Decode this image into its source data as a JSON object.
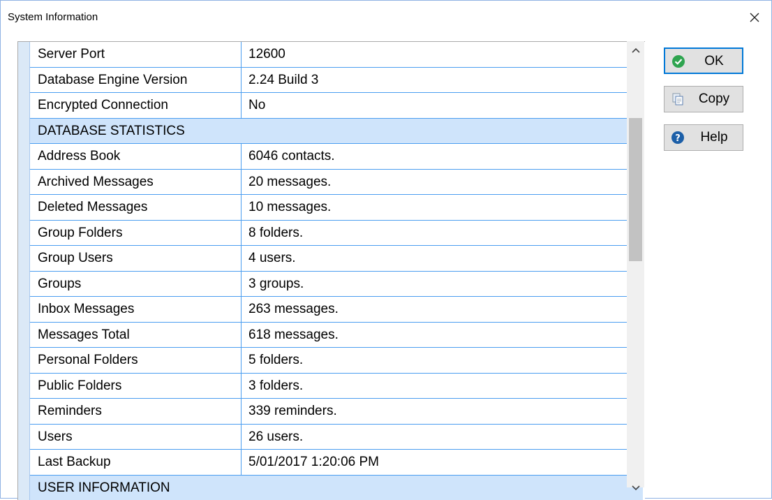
{
  "window": {
    "title": "System Information",
    "close_glyph": "✕"
  },
  "properties": [
    {
      "name": "Server Port",
      "value": "12600"
    },
    {
      "name": "Database Engine Version",
      "value": "2.24 Build 3"
    },
    {
      "name": "Encrypted Connection",
      "value": "No"
    },
    {
      "section": "DATABASE STATISTICS"
    },
    {
      "name": "Address Book",
      "value": "6046 contacts."
    },
    {
      "name": "Archived Messages",
      "value": "20 messages."
    },
    {
      "name": "Deleted Messages",
      "value": "10 messages."
    },
    {
      "name": "Group Folders",
      "value": "8 folders."
    },
    {
      "name": "Group Users",
      "value": "4 users."
    },
    {
      "name": "Groups",
      "value": "3 groups."
    },
    {
      "name": "Inbox Messages",
      "value": "263 messages."
    },
    {
      "name": "Messages Total",
      "value": "618 messages."
    },
    {
      "name": "Personal Folders",
      "value": "5 folders."
    },
    {
      "name": "Public Folders",
      "value": "3 folders."
    },
    {
      "name": "Reminders",
      "value": "339 reminders."
    },
    {
      "name": "Users",
      "value": "26 users."
    },
    {
      "name": "Last Backup",
      "value": "5/01/2017 1:20:06 PM"
    },
    {
      "section": "USER INFORMATION"
    }
  ],
  "buttons": {
    "ok": {
      "label": "OK",
      "icon": "check-circle-icon"
    },
    "copy": {
      "label": "Copy",
      "icon": "copy-icon"
    },
    "help": {
      "label": "Help",
      "icon": "question-circle-icon"
    }
  },
  "colors": {
    "grid_line": "#4a9df0",
    "section_bg": "#cfe4fb",
    "ok_icon": "#2ea44f",
    "help_icon": "#1c5fa8"
  }
}
